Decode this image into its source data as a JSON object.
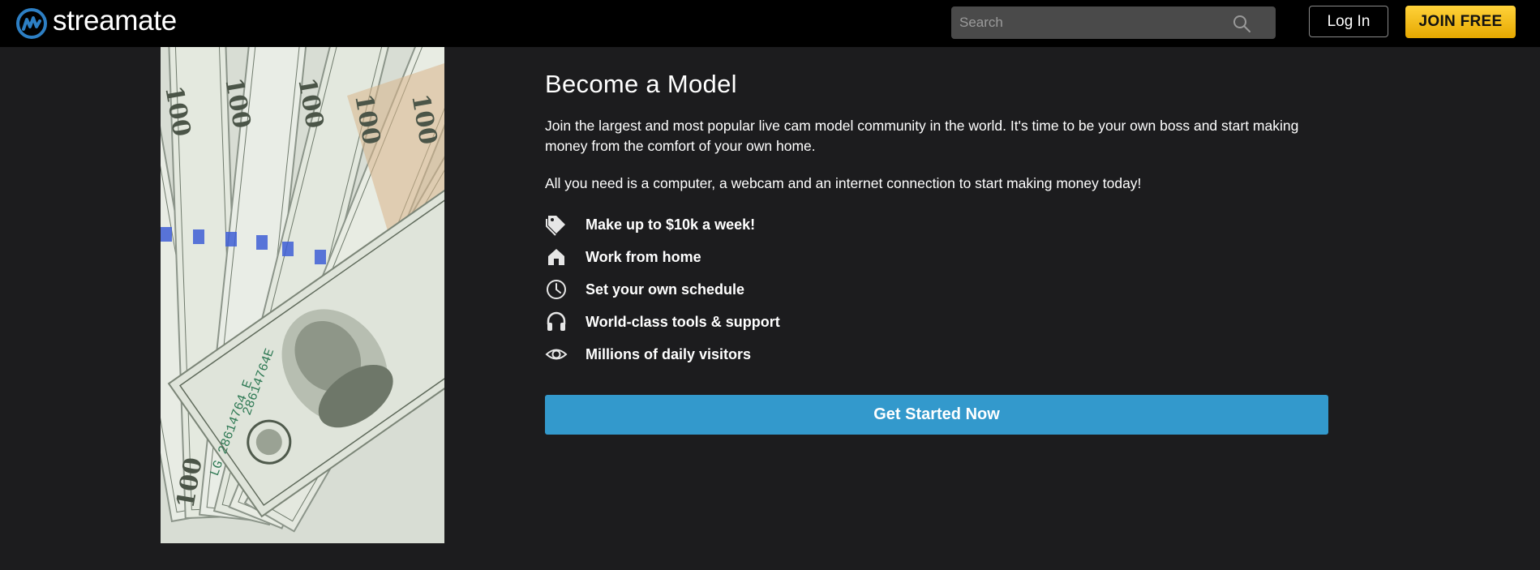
{
  "header": {
    "logo_text": "streamate",
    "search_placeholder": "Search",
    "login_label": "Log In",
    "join_label": "JOIN FREE"
  },
  "hero": {
    "image_alt": "money-bills-fan",
    "banknote_text": "100"
  },
  "main": {
    "title": "Become a Model",
    "paragraph_1": "Join the largest and most popular live cam model community in the world. It's time to be your own boss and start making money from the comfort of your own home.",
    "paragraph_2": "All you need is a computer, a webcam and an internet connection to start making money today!",
    "features": [
      {
        "icon": "tag-icon",
        "label": "Make up to $10k a week!"
      },
      {
        "icon": "home-icon",
        "label": "Work from home"
      },
      {
        "icon": "clock-icon",
        "label": "Set your own schedule"
      },
      {
        "icon": "headset-icon",
        "label": "World-class tools & support"
      },
      {
        "icon": "eye-icon",
        "label": "Millions of daily visitors"
      }
    ],
    "cta_label": "Get Started Now"
  },
  "colors": {
    "page_background": "#1c1c1e",
    "header_background": "#000000",
    "join_button": "#f5bd14",
    "cta_button": "#3399cc",
    "logo_accent": "#2d7fc4"
  }
}
